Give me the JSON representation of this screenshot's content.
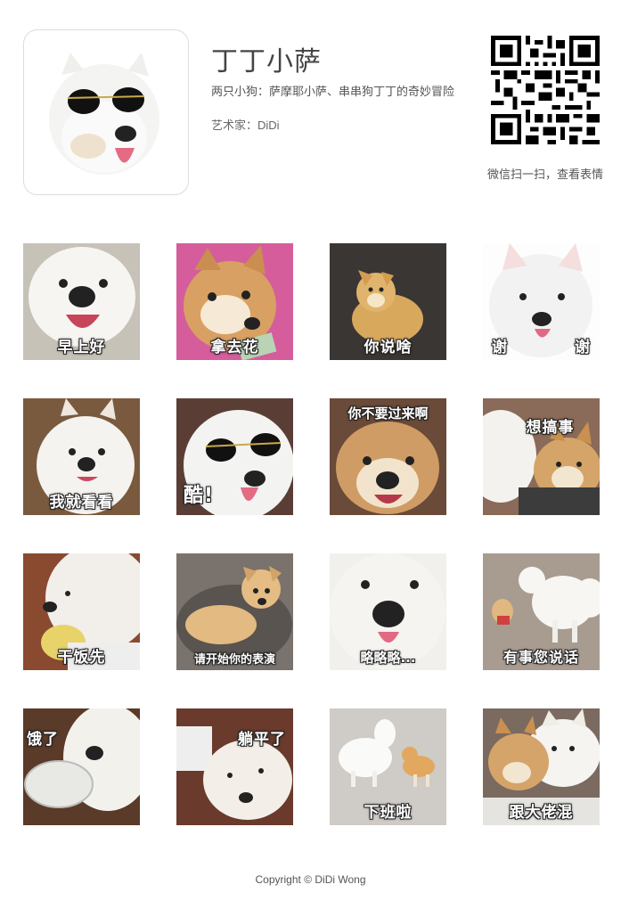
{
  "header": {
    "title": "丁丁小萨",
    "subtitle": "两只小狗：萨摩耶小萨、串串狗丁丁的奇妙冒险",
    "artist": "艺术家：DiDi",
    "qr_caption": "微信扫一扫，查看表情"
  },
  "stickers": [
    {
      "caption": "早上好",
      "dog": "samoyed"
    },
    {
      "caption": "拿去花",
      "dog": "shiba"
    },
    {
      "caption": "你说啥",
      "dog": "shiba"
    },
    {
      "caption_left": "谢",
      "caption_right": "谢",
      "dog": "samoyed"
    },
    {
      "caption": "我就看看",
      "dog": "samoyed"
    },
    {
      "caption": "酷!",
      "dog": "samoyed"
    },
    {
      "caption": "你不要过来啊",
      "dog": "shiba"
    },
    {
      "caption": "想搞事",
      "dog": "both"
    },
    {
      "caption": "干饭先",
      "dog": "samoyed"
    },
    {
      "caption": "请开始你的表演",
      "dog": "shiba"
    },
    {
      "caption": "略略略...",
      "dog": "samoyed"
    },
    {
      "caption": "有事您说话",
      "dog": "both"
    },
    {
      "caption": "饿了",
      "dog": "samoyed"
    },
    {
      "caption": "躺平了",
      "dog": "samoyed"
    },
    {
      "caption": "下班啦",
      "dog": "both"
    },
    {
      "caption": "跟大佬混",
      "dog": "both"
    }
  ],
  "footer": {
    "copyright": "Copyright © DiDi Wong"
  }
}
